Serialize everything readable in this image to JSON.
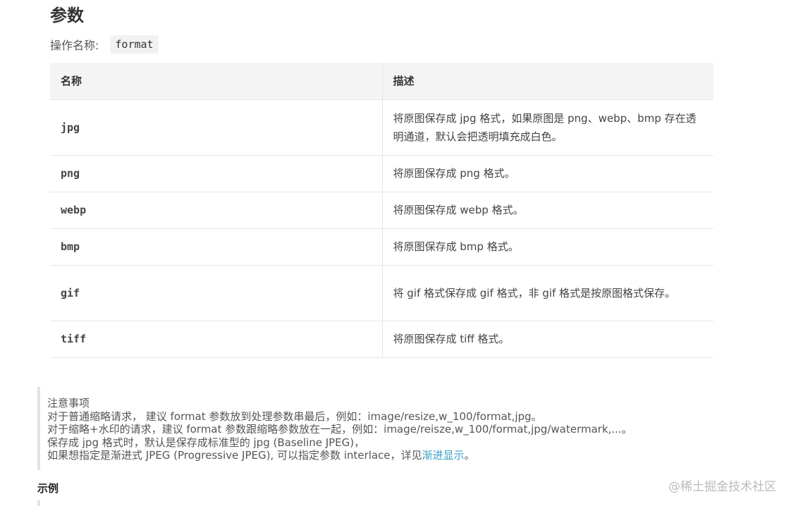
{
  "section": {
    "title": "参数"
  },
  "operation": {
    "label": "操作名称:",
    "value": "format"
  },
  "table": {
    "headers": [
      "名称",
      "描述"
    ],
    "rows": [
      {
        "name": "jpg",
        "desc": "将原图保存成 jpg 格式，如果原图是 png、webp、bmp 存在透明通道，默认会把透明填充成白色。"
      },
      {
        "name": "png",
        "desc": "将原图保存成 png 格式。"
      },
      {
        "name": "webp",
        "desc": "将原图保存成 webp 格式。"
      },
      {
        "name": "bmp",
        "desc": "将原图保存成 bmp 格式。"
      },
      {
        "name": "gif",
        "desc": "将 gif 格式保存成 gif 格式，非 gif 格式是按原图格式保存。"
      },
      {
        "name": "tiff",
        "desc": "将原图保存成 tiff 格式。"
      }
    ]
  },
  "note": {
    "title": "注意事项",
    "line1": "对于普通缩略请求， 建议 format 参数放到处理参数串最后，例如：image/resize,w_100/format,jpg。",
    "line2": "对于缩略+水印的请求，建议 format 参数跟缩略参数放在一起，例如：image/reisze,w_100/format,jpg/watermark,...。",
    "line3": "保存成 jpg 格式时，默认是保存成标准型的 jpg (Baseline JPEG)，",
    "line4_prefix": "如果想指定是渐进式 JPEG (Progressive JPEG), 可以指定参数 interlace，详见",
    "line4_link": "渐进显示",
    "line4_suffix": "。"
  },
  "example": {
    "title": "示例"
  },
  "watermark": "@稀土掘金技术社区"
}
